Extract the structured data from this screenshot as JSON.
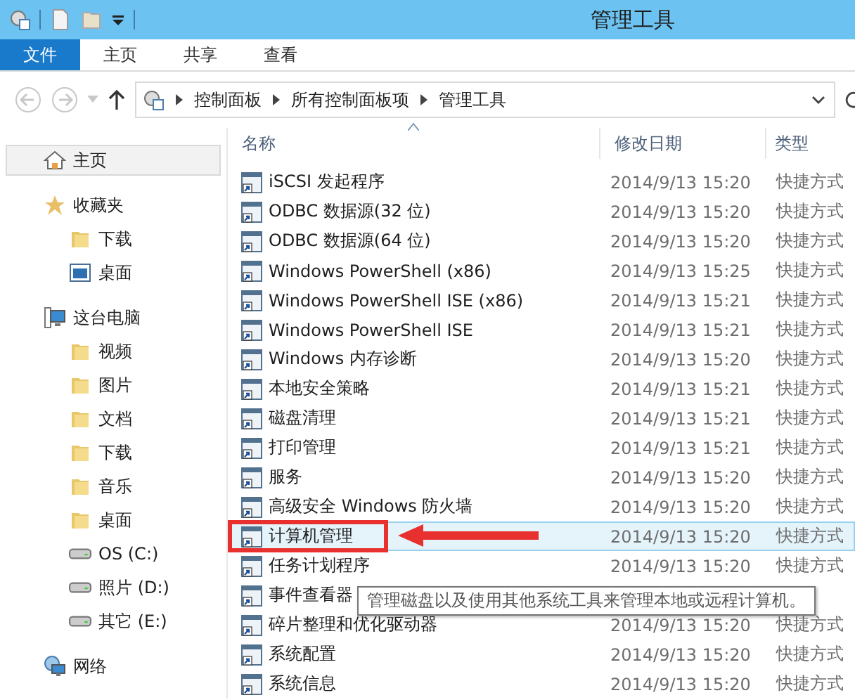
{
  "window": {
    "title": "管理工具"
  },
  "ribbon_tabs": [
    {
      "label": "文件",
      "selected": true
    },
    {
      "label": "主页",
      "selected": false
    },
    {
      "label": "共享",
      "selected": false
    },
    {
      "label": "查看",
      "selected": false
    }
  ],
  "address_bar": {
    "breadcrumbs": [
      "控制面板",
      "所有控制面板项",
      "管理工具"
    ]
  },
  "sidebar": {
    "items": [
      {
        "label": "主页",
        "kind": "home",
        "selected": true
      },
      {
        "label": "收藏夹",
        "kind": "star",
        "selected": false,
        "children": [
          {
            "label": "下载",
            "kind": "folder",
            "selected": false
          },
          {
            "label": "桌面",
            "kind": "desktop",
            "selected": false
          }
        ]
      },
      {
        "label": "这台电脑",
        "kind": "computer",
        "selected": false,
        "children": [
          {
            "label": "视频",
            "kind": "folder",
            "selected": false
          },
          {
            "label": "图片",
            "kind": "folder",
            "selected": false
          },
          {
            "label": "文档",
            "kind": "folder",
            "selected": false
          },
          {
            "label": "下载",
            "kind": "folder",
            "selected": false
          },
          {
            "label": "音乐",
            "kind": "folder",
            "selected": false
          },
          {
            "label": "桌面",
            "kind": "folder",
            "selected": false
          },
          {
            "label": "OS (C:)",
            "kind": "drive",
            "selected": false
          },
          {
            "label": "照片 (D:)",
            "kind": "drive",
            "selected": false
          },
          {
            "label": "其它 (E:)",
            "kind": "drive",
            "selected": false
          }
        ]
      },
      {
        "label": "网络",
        "kind": "network",
        "selected": false
      }
    ]
  },
  "table": {
    "columns": [
      "名称",
      "修改日期",
      "类型"
    ],
    "rows": [
      {
        "name": "iSCSI 发起程序",
        "date": "2014/9/13 15:20",
        "type": "快捷方式",
        "selected": false
      },
      {
        "name": "ODBC 数据源(32 位)",
        "date": "2014/9/13 15:20",
        "type": "快捷方式",
        "selected": false
      },
      {
        "name": "ODBC 数据源(64 位)",
        "date": "2014/9/13 15:20",
        "type": "快捷方式",
        "selected": false
      },
      {
        "name": "Windows PowerShell (x86)",
        "date": "2014/9/13 15:25",
        "type": "快捷方式",
        "selected": false
      },
      {
        "name": "Windows PowerShell ISE (x86)",
        "date": "2014/9/13 15:21",
        "type": "快捷方式",
        "selected": false
      },
      {
        "name": "Windows PowerShell ISE",
        "date": "2014/9/13 15:21",
        "type": "快捷方式",
        "selected": false
      },
      {
        "name": "Windows 内存诊断",
        "date": "2014/9/13 15:20",
        "type": "快捷方式",
        "selected": false
      },
      {
        "name": "本地安全策略",
        "date": "2014/9/13 15:21",
        "type": "快捷方式",
        "selected": false
      },
      {
        "name": "磁盘清理",
        "date": "2014/9/13 15:21",
        "type": "快捷方式",
        "selected": false
      },
      {
        "name": "打印管理",
        "date": "2014/9/13 15:21",
        "type": "快捷方式",
        "selected": false
      },
      {
        "name": "服务",
        "date": "2014/9/13 15:20",
        "type": "快捷方式",
        "selected": false
      },
      {
        "name": "高级安全 Windows 防火墙",
        "date": "2014/9/13 15:20",
        "type": "快捷方式",
        "selected": false
      },
      {
        "name": "计算机管理",
        "date": "2014/9/13 15:20",
        "type": "快捷方式",
        "selected": true,
        "annotated": true
      },
      {
        "name": "任务计划程序",
        "date": "2014/9/13 15:20",
        "type": "快捷方式",
        "selected": false
      },
      {
        "name": "事件查看器",
        "selected": false
      },
      {
        "name": "碎片整理和优化驱动器",
        "date": "2014/9/13 15:20",
        "type": "快捷方式",
        "selected": false
      },
      {
        "name": "系统配置",
        "date": "2014/9/13 15:20",
        "type": "快捷方式",
        "selected": false
      },
      {
        "name": "系统信息",
        "date": "2014/9/13 15:20",
        "type": "快捷方式",
        "selected": false
      }
    ]
  },
  "tooltip": {
    "text": "管理磁盘以及使用其他系统工具来管理本地或远程计算机。"
  }
}
